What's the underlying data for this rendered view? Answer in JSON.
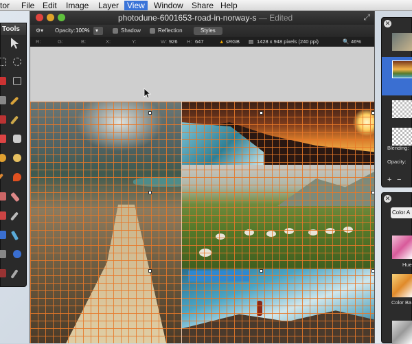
{
  "menubar": {
    "app": "tor",
    "items": [
      "File",
      "Edit",
      "Image",
      "Layer",
      "View",
      "Window",
      "Share",
      "Help"
    ],
    "selected": "View"
  },
  "tools_panel": {
    "title": "Tools"
  },
  "window": {
    "filename": "photodune-6001653-road-in-norway-s",
    "status": "— Edited"
  },
  "toolbar": {
    "opacity_label": "Opacity:",
    "opacity_value": "100%",
    "shadow_label": "Shadow",
    "reflection_label": "Reflection",
    "styles_label": "Styles"
  },
  "infobar": {
    "r_label": "R:",
    "g_label": "G:",
    "b_label": "B:",
    "x_label": "X:",
    "y_label": "Y:",
    "w_label": "W:",
    "w_value": "926",
    "h_label": "H:",
    "h_value": "647",
    "colorspace": "sRGB",
    "dimensions": "1428 x 948 pixels (240 ppi)",
    "zoom": "46%"
  },
  "layers_panel": {
    "blending_label": "Blending:",
    "opacity_label": "Opacity:",
    "add": "+",
    "remove": "−"
  },
  "adjustments_panel": {
    "dropdown": "Color A",
    "items": [
      "Hue",
      "Color Ba"
    ]
  },
  "colors": {
    "grid": "#e87828",
    "selection_blue": "#3a6fd2"
  }
}
